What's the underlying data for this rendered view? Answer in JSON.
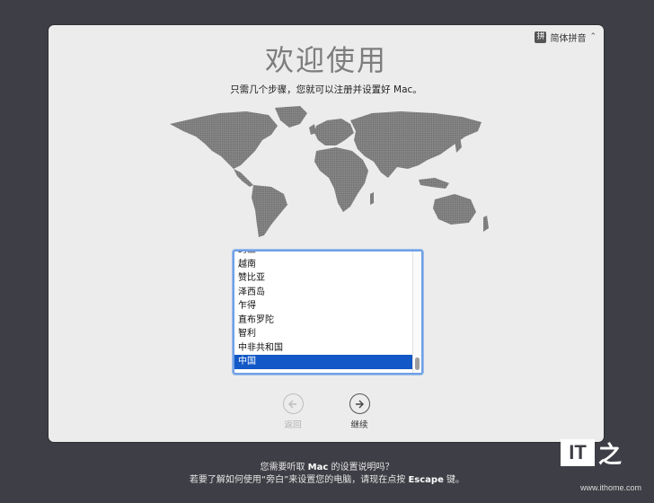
{
  "input_source": {
    "icon_char": "拼",
    "label": "简体拼音",
    "arrows": "⌃⌄"
  },
  "title": "欢迎使用",
  "subtitle": "只需几个步骤，您就可以注册并设置好 Mac。",
  "country_list": {
    "items": [
      "约旦",
      "越南",
      "赞比亚",
      "泽西岛",
      "乍得",
      "直布罗陀",
      "智利",
      "中非共和国",
      "中国"
    ],
    "selected": "中国"
  },
  "nav": {
    "back_label": "返回",
    "continue_label": "继续"
  },
  "voiceover": {
    "line1_pre": "您需要听取 ",
    "line1_bold": "Mac",
    "line1_post": " 的设置说明吗？",
    "line2_pre": "若要了解如何使用“旁白”来设置您的电脑，请现在点按 ",
    "line2_bold": "Escape",
    "line2_post": " 键。"
  },
  "watermark": {
    "logo": "IT",
    "char": "之",
    "url": "www.ithome.com"
  },
  "colors": {
    "background": "#3e3e46",
    "window": "#ececec",
    "selection": "#1258c7",
    "focus_ring": "#6fa0e6",
    "map": "#7a7a7a"
  }
}
